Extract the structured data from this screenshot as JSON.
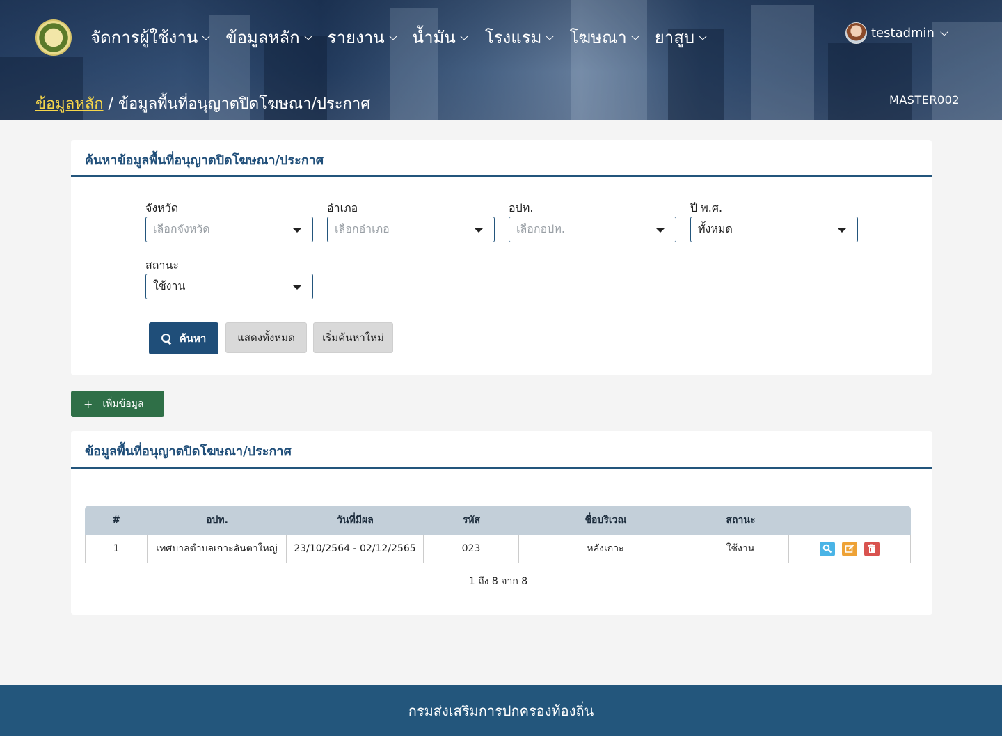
{
  "nav": {
    "items": [
      {
        "label": "จัดการผู้ใช้งาน"
      },
      {
        "label": "ข้อมูลหลัก"
      },
      {
        "label": "รายงาน"
      },
      {
        "label": "น้ำมัน"
      },
      {
        "label": "โรงแรม"
      },
      {
        "label": "โฆษณา"
      },
      {
        "label": "ยาสูบ"
      }
    ]
  },
  "user": {
    "name": "testadmin"
  },
  "breadcrumb": {
    "root": "ข้อมูลหลัก",
    "separator": " / ",
    "current": "ข้อมูลพื้นที่อนุญาตปิดโฆษณา/ประกาศ"
  },
  "page_code": "MASTER002",
  "search": {
    "title": "ค้นหาข้อมูลพื้นที่อนุญาตปิดโฆษณา/ประกาศ",
    "fields": {
      "province": {
        "label": "จังหวัด",
        "value": "เลือกจังหวัด"
      },
      "district": {
        "label": "อำเภอ",
        "value": "เลือกอำเภอ"
      },
      "lao": {
        "label": "อปท.",
        "value": "เลือกอปท."
      },
      "year": {
        "label": "ปี พ.ศ.",
        "value": "ทั้งหมด"
      },
      "status": {
        "label": "สถานะ",
        "value": "ใช้งาน"
      }
    },
    "buttons": {
      "search": "ค้นหา",
      "show_all": "แสดงทั้งหมด",
      "reset": "เริ่มค้นหาใหม่"
    }
  },
  "add_button": "เพิ่มข้อมูล",
  "table": {
    "title": "ข้อมูลพื้นที่อนุญาตปิดโฆษณา/ประกาศ",
    "columns": [
      "#",
      "อปท.",
      "วันที่มีผล",
      "รหัส",
      "ชื่อบริเวณ",
      "สถานะ",
      ""
    ],
    "rows": [
      {
        "no": "1",
        "lao": "เทศบาลตำบลเกาะลันตาใหญ่",
        "effective": "23/10/2564 - 02/12/2565",
        "code": "023",
        "area": "หลังเกาะ",
        "status": "ใช้งาน"
      }
    ],
    "pager": "1 ถึง 8 จาก 8"
  },
  "footer": "กรมส่งเสริมการปกครองท้องถิ่น",
  "colors": {
    "primary": "#1f4e79",
    "add": "#2f6f47",
    "view": "#4ab4e6",
    "edit": "#eea236",
    "delete": "#d9534f",
    "breadcrumb_link": "#f6d64a"
  },
  "icons": {
    "search": "search-icon",
    "view": "magnifier-icon",
    "edit": "edit-icon",
    "delete": "trash-icon",
    "add": "plus-icon"
  }
}
